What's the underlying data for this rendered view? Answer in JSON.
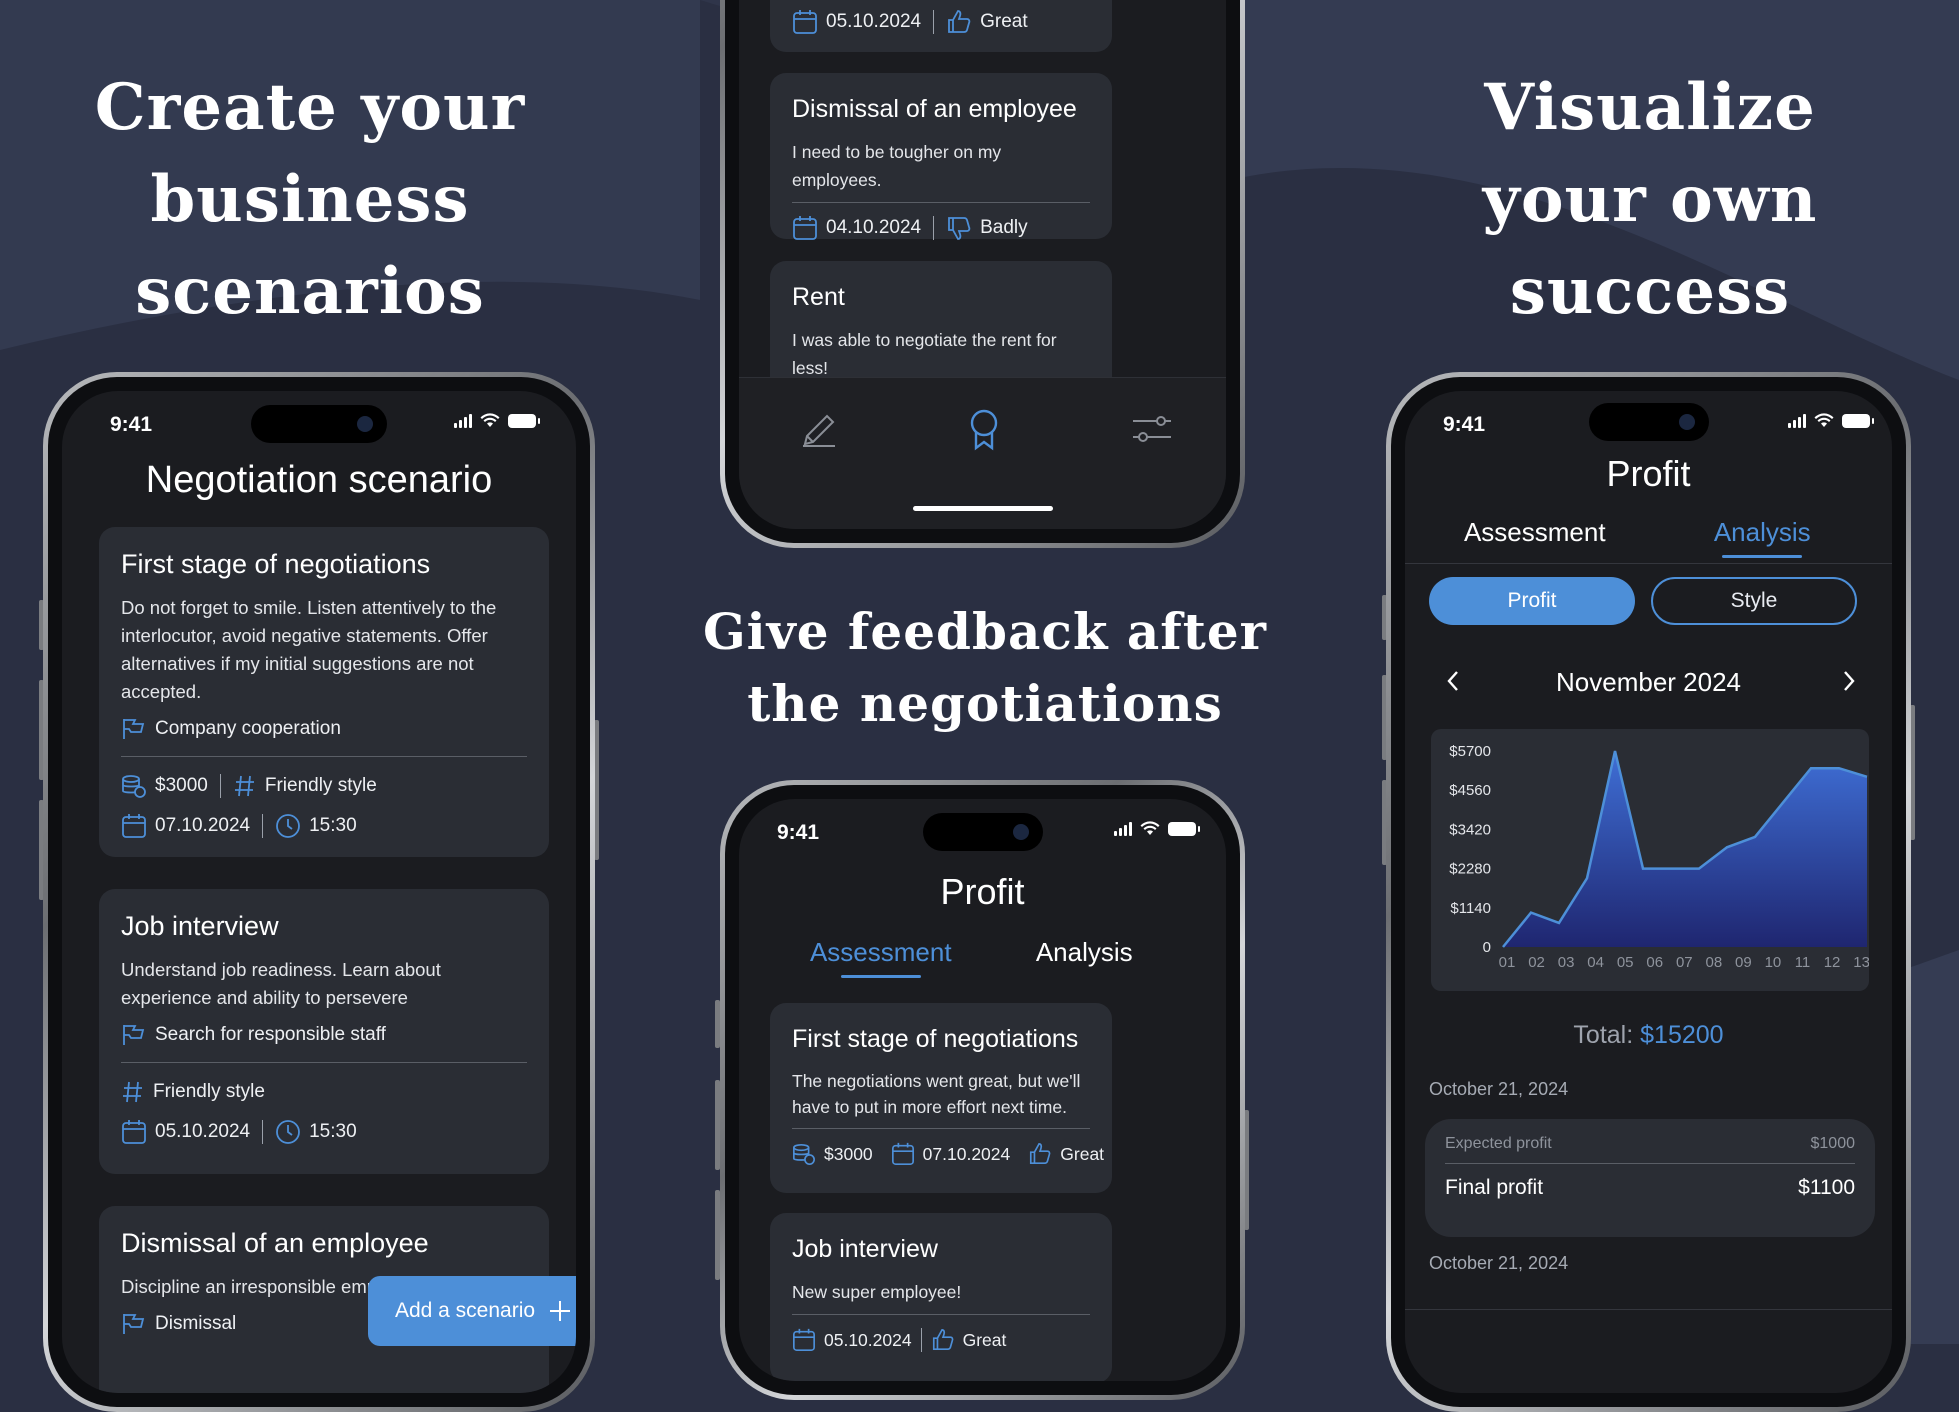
{
  "headlines": {
    "left": [
      "Create your",
      "business",
      "scenarios"
    ],
    "middle": [
      "Give feedback after",
      "the negotiations"
    ],
    "right": [
      "Visualize",
      "your own",
      "success"
    ]
  },
  "colors": {
    "accent": "#4d8fd8",
    "background": "#2a2f42",
    "card": "#2a2d34",
    "screen": "#1b1c20"
  },
  "status_bar": {
    "time": "9:41"
  },
  "phone_left": {
    "title": "Negotiation scenario",
    "cards": [
      {
        "title": "First stage of negotiations",
        "text": "Do not forget to smile. Listen attentively to the interlocutor, avoid negative statements. Offer alternatives if my initial suggestions are not accepted.",
        "category": "Company cooperation",
        "budget": "$3000",
        "style": "Friendly style",
        "date": "07.10.2024",
        "time": "15:30"
      },
      {
        "title": "Job interview",
        "text": "Understand job readiness. Learn about experience and ability to persevere",
        "category": "Search for responsible staff",
        "style": "Friendly style",
        "date": "05.10.2024",
        "time": "15:30"
      },
      {
        "title": "Dismissal of an employee",
        "text": "Discipline an irresponsible employee",
        "category": "Dismissal"
      }
    ],
    "add_button": "Add a scenario"
  },
  "phone_top": {
    "partial_card": {
      "date": "05.10.2024",
      "rating": "Great"
    },
    "cards": [
      {
        "title": "Dismissal of an employee",
        "text": "I need to be tougher on my employees.",
        "date": "04.10.2024",
        "rating": "Badly"
      },
      {
        "title": "Rent",
        "text": "I was able to negotiate the rent for less!"
      }
    ],
    "nav": [
      "pen-icon",
      "award-icon",
      "settings-sliders-icon"
    ]
  },
  "phone_middle": {
    "title": "Profit",
    "tabs": [
      "Assessment",
      "Analysis"
    ],
    "active_tab": "Assessment",
    "cards": [
      {
        "title": "First stage of negotiations",
        "text": "The negotiations went great, but we'll have to put in more effort next time.",
        "budget": "$3000",
        "date": "07.10.2024",
        "rating": "Great"
      },
      {
        "title": "Job interview",
        "text": "New super employee!",
        "date": "05.10.2024",
        "rating": "Great"
      }
    ]
  },
  "phone_right": {
    "title": "Profit",
    "tabs": [
      "Assessment",
      "Analysis"
    ],
    "active_tab": "Analysis",
    "toggle": [
      "Profit",
      "Style"
    ],
    "month": "November 2024",
    "total_label": "Total:",
    "total_value": "$15200",
    "entries": [
      {
        "date": "October 21, 2024",
        "expected_label": "Expected profit",
        "expected_value": "$1000",
        "final_label": "Final profit",
        "final_value": "$1100"
      },
      {
        "date": "October 21, 2024"
      }
    ]
  },
  "chart_data": {
    "type": "area",
    "x": [
      "01",
      "02",
      "03",
      "04",
      "05",
      "06",
      "07",
      "08",
      "09",
      "10",
      "11",
      "12",
      "13"
    ],
    "y_ticks": [
      "$5700",
      "$4560",
      "$3420",
      "$2280",
      "$1140",
      "0"
    ],
    "ylim": [
      0,
      5700
    ],
    "series": [
      {
        "values": [
          0,
          1000,
          700,
          2000,
          5700,
          2280,
          2280,
          2280,
          2900,
          3200,
          4200,
          5200,
          5200,
          4950
        ]
      }
    ],
    "grid": false
  }
}
